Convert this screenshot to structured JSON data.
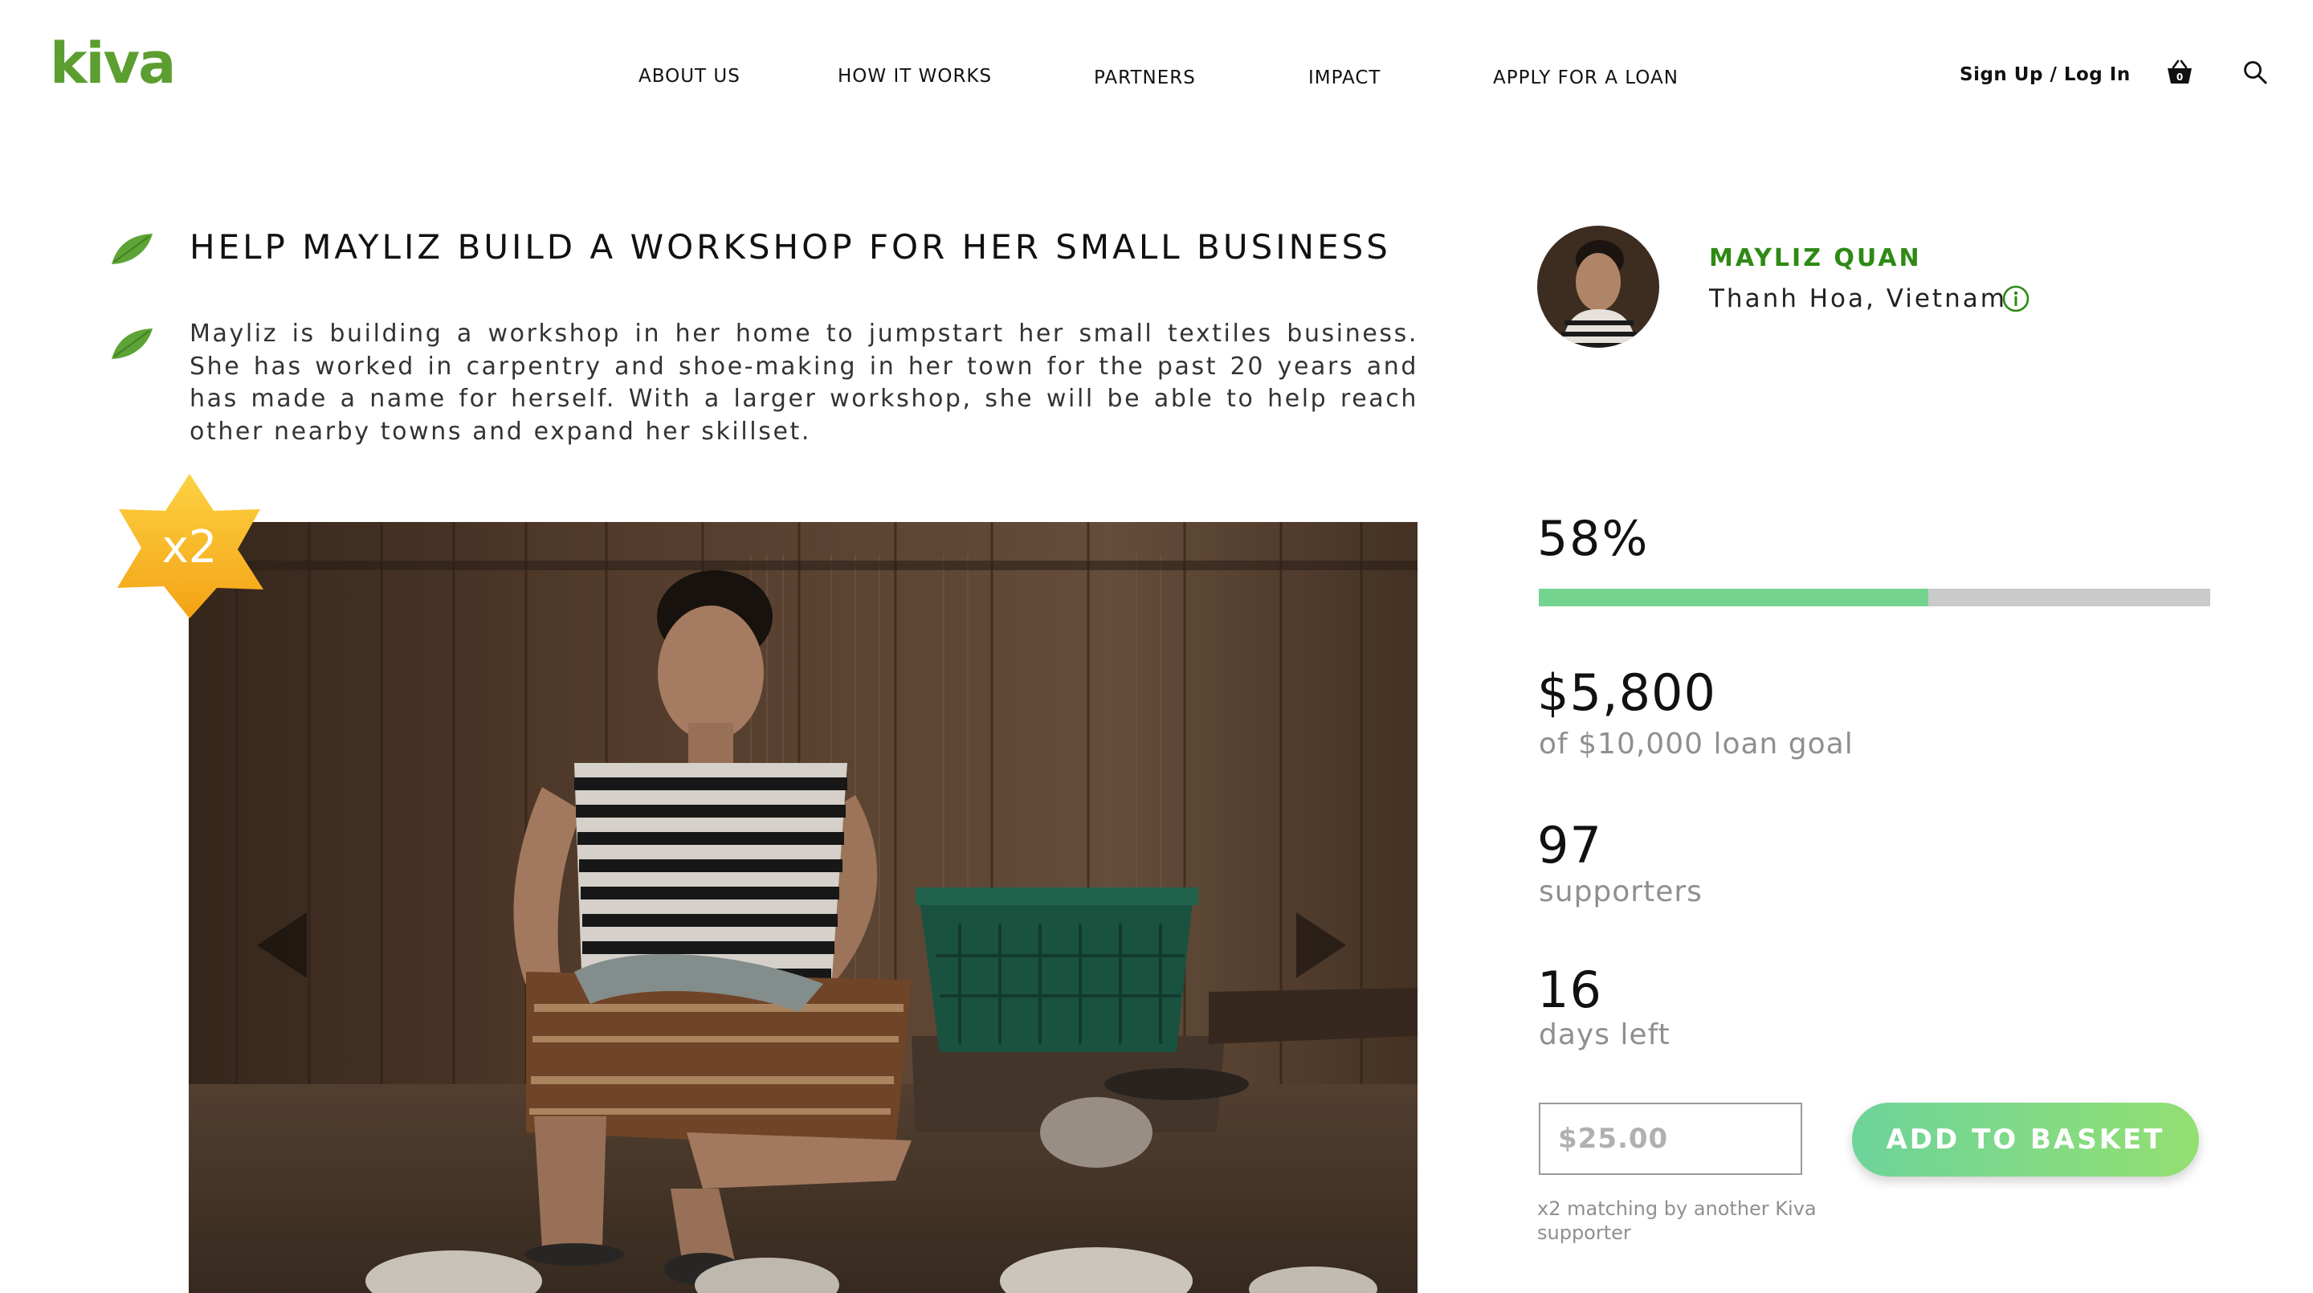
{
  "brand": {
    "logo_text": "kiva",
    "color": "#5c9e30"
  },
  "nav": {
    "items": [
      {
        "label": "ABOUT US"
      },
      {
        "label": "HOW IT WORKS"
      },
      {
        "label": "PARTNERS"
      },
      {
        "label": "IMPACT"
      },
      {
        "label": "APPLY FOR A LOAN"
      }
    ],
    "auth_label": "Sign Up / Log In",
    "basket_count": "0",
    "basket_icon": "basket-icon",
    "search_icon": "search-icon"
  },
  "loan": {
    "title": "HELP MAYLIZ BUILD A WORKSHOP FOR HER SMALL BUSINESS",
    "description": "Mayliz is building a workshop in her home to jumpstart her small textiles business. She has worked in carpentry and shoe-making in her town for the past 20 years and has made a name for herself. With a larger workshop, she will be able to help reach other nearby towns and expand her skillset.",
    "match_badge": "x2",
    "leaf_icon": "leaf-icon",
    "prev_icon": "chevron-left-icon",
    "next_icon": "chevron-right-icon"
  },
  "borrower": {
    "name": "MAYLIZ QUAN",
    "location": "Thanh Hoa, Vietnam",
    "name_color": "#2e8a14",
    "info_icon": "info-icon"
  },
  "stats": {
    "percent_label": "58%",
    "percent_funded": 0.58,
    "raised": "$5,800",
    "goal_label": "of $10,000 loan goal",
    "supporters_count": "97",
    "supporters_label": "supporters",
    "days_count": "16",
    "days_label": "days left"
  },
  "lend": {
    "amount_placeholder": "$25.00",
    "add_button_label": "ADD TO BASKET",
    "match_note": "x2 matching by another Kiva supporter"
  },
  "colors": {
    "progress_fill": "#74d48f",
    "progress_track": "#cacaca",
    "button_gradient_start": "#6dd49a",
    "button_gradient_end": "#93df72",
    "badge_gold": "#f6b418"
  }
}
